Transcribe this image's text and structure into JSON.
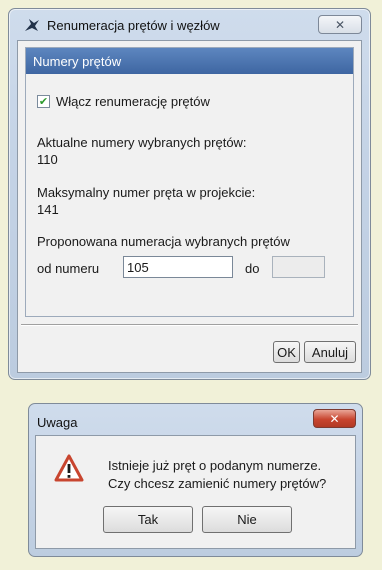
{
  "main_dialog": {
    "title": "Renumeracja prętów i węzłów",
    "group_title": "Numery prętów",
    "enable_checkbox": {
      "label": "Włącz renumerację prętów",
      "checked": true
    },
    "current_numbers_label": "Aktualne numery wybranych prętów:",
    "current_numbers_value": "110",
    "max_number_label": "Maksymalny numer pręta w projekcie:",
    "max_number_value": "141",
    "proposed_label": "Proponowana numeracja wybranych prętów",
    "from_label": "od numeru",
    "from_value": "105",
    "to_label": "do",
    "to_value": "",
    "ok_label": "OK",
    "cancel_label": "Anuluj"
  },
  "warning_dialog": {
    "title": "Uwaga",
    "message_line1": "Istnieje już pręt o podanym numerze.",
    "message_line2": "Czy chcesz zamienić numery prętów?",
    "yes_label": "Tak",
    "no_label": "Nie"
  },
  "icons": {
    "close": "close-icon",
    "app": "app-icon",
    "warning": "warning-icon",
    "check": "check-icon"
  },
  "colors": {
    "group_header": "#3e66a2",
    "checkmark": "#2c9a2c",
    "warning_red": "#c8452f"
  }
}
